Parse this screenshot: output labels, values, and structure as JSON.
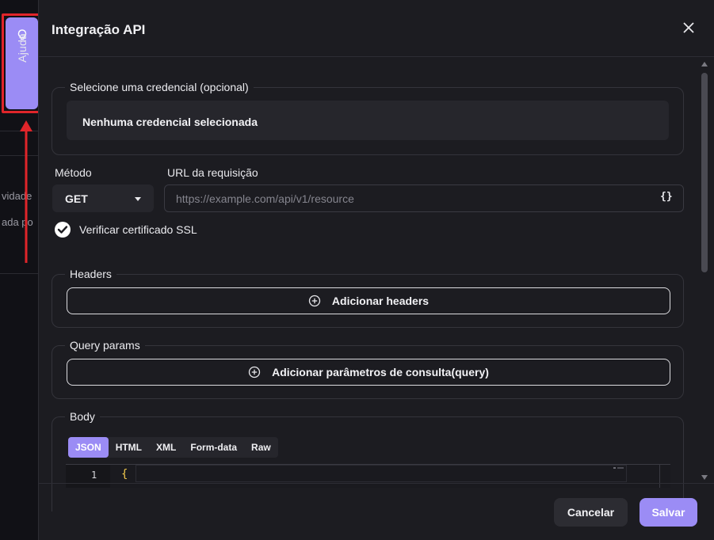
{
  "background": {
    "fragments": [
      "vidade",
      "ada po"
    ]
  },
  "help_tab": {
    "label": "Ajuda",
    "icon": "lightbulb-icon",
    "highlight_color": "#e0252a"
  },
  "dialog": {
    "title": "Integração API",
    "close_icon": "close-icon",
    "credential": {
      "legend": "Selecione uma credencial (opcional)",
      "value": "Nenhuma credencial selecionada"
    },
    "method": {
      "label": "Método",
      "value": "GET"
    },
    "url": {
      "label": "URL da requisição",
      "placeholder": "https://example.com/api/v1/resource",
      "value": "",
      "braces": "{}"
    },
    "ssl": {
      "label": "Verificar certificado SSL",
      "checked": true
    },
    "headers": {
      "legend": "Headers",
      "add_label": "Adicionar headers"
    },
    "query": {
      "legend": "Query params",
      "add_label": "Adicionar parâmetros de consulta(query)"
    },
    "body": {
      "legend": "Body",
      "tabs": [
        "JSON",
        "HTML",
        "XML",
        "Form-data",
        "Raw"
      ],
      "active_tab": "JSON",
      "editor": {
        "line_number": "1",
        "code": "{"
      }
    },
    "footer": {
      "cancel_label": "Cancelar",
      "save_label": "Salvar"
    }
  },
  "colors": {
    "accent": "#9b8cf5",
    "dialog_bg": "#1c1c21",
    "highlight": "#e0252a"
  }
}
